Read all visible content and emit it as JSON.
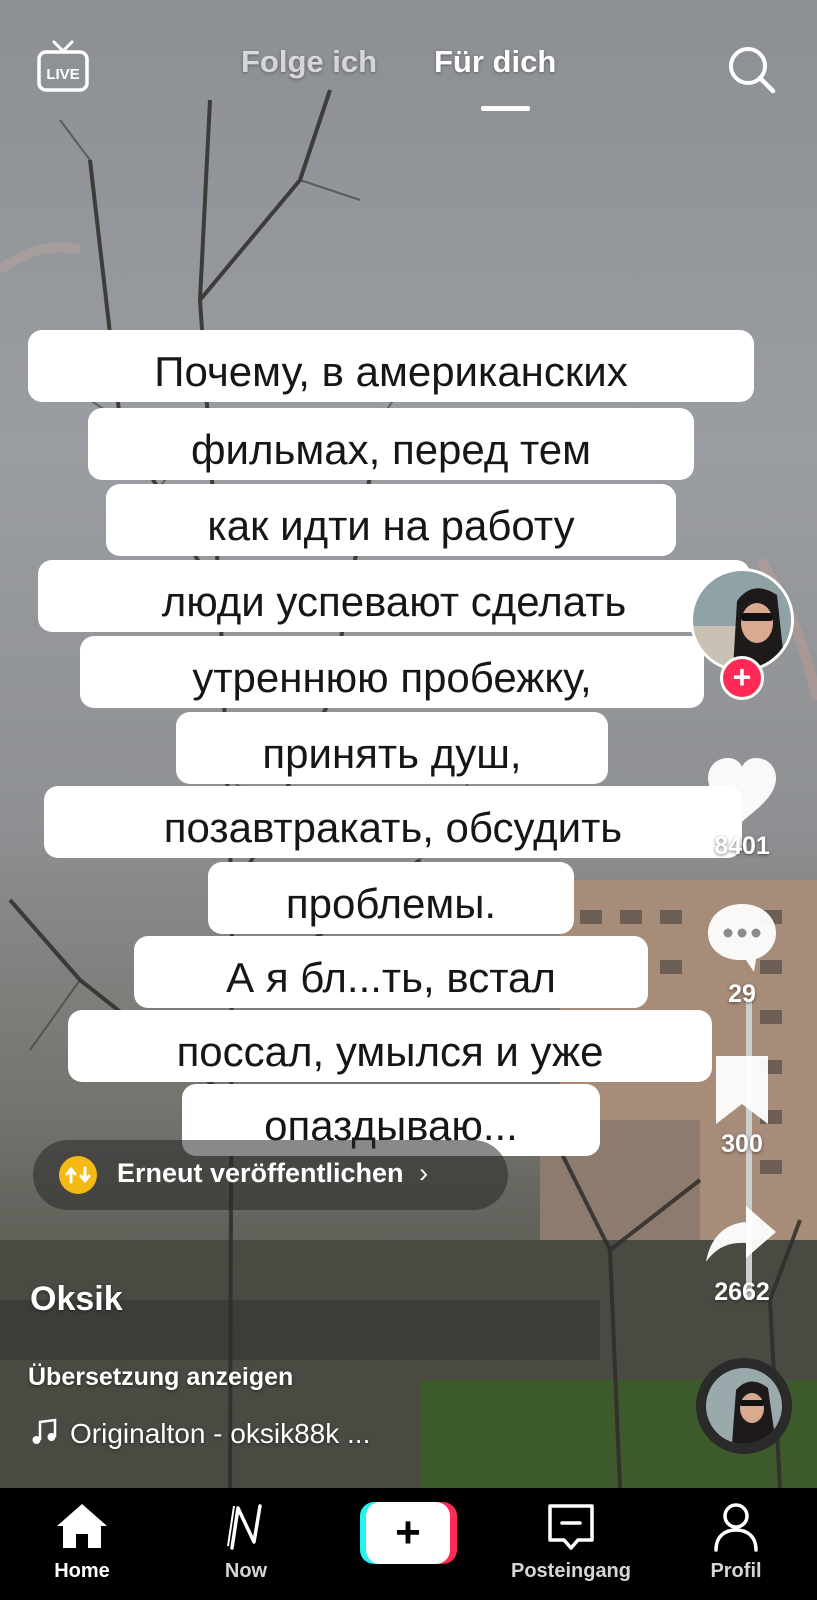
{
  "top_bar": {
    "live_label": "LIVE",
    "tabs": [
      {
        "label": "Folge ich",
        "active": false
      },
      {
        "label": "Für dich",
        "active": true
      }
    ]
  },
  "caption": {
    "lines": [
      "Почему, в американских",
      "фильмах, перед тем",
      "как идти на работу",
      "люди успевают сделать",
      "утреннюю пробежку,",
      "принять душ,",
      "позавтракать, обсудить",
      "проблемы.",
      "А я бл...ть, встал",
      "поссал, умылся и уже",
      "опаздываю..."
    ]
  },
  "repost": {
    "label": "Erneut veröffentlichen",
    "chevron": "›"
  },
  "actions": {
    "follow_symbol": "+",
    "likes": "8401",
    "comments": "29",
    "saves": "300",
    "shares": "2662"
  },
  "video_info": {
    "username": "Oksik",
    "translate_label": "Übersetzung anzeigen",
    "sound": "Originalton - oksik88k ..."
  },
  "bottom_nav": {
    "items": [
      {
        "label": "Home",
        "icon": "home-icon",
        "active": true
      },
      {
        "label": "Now",
        "icon": "now-icon",
        "active": false
      },
      {
        "label": "",
        "icon": "plus-icon",
        "active": false
      },
      {
        "label": "Posteingang",
        "icon": "inbox-icon",
        "active": false
      },
      {
        "label": "Profil",
        "icon": "profile-icon",
        "active": false
      }
    ],
    "create_symbol": "+"
  },
  "colors": {
    "follow_red": "#ff2a55",
    "repost_yellow": "#f5b914",
    "create_cyan": "#25f4ee",
    "create_pink": "#fe2c55"
  }
}
